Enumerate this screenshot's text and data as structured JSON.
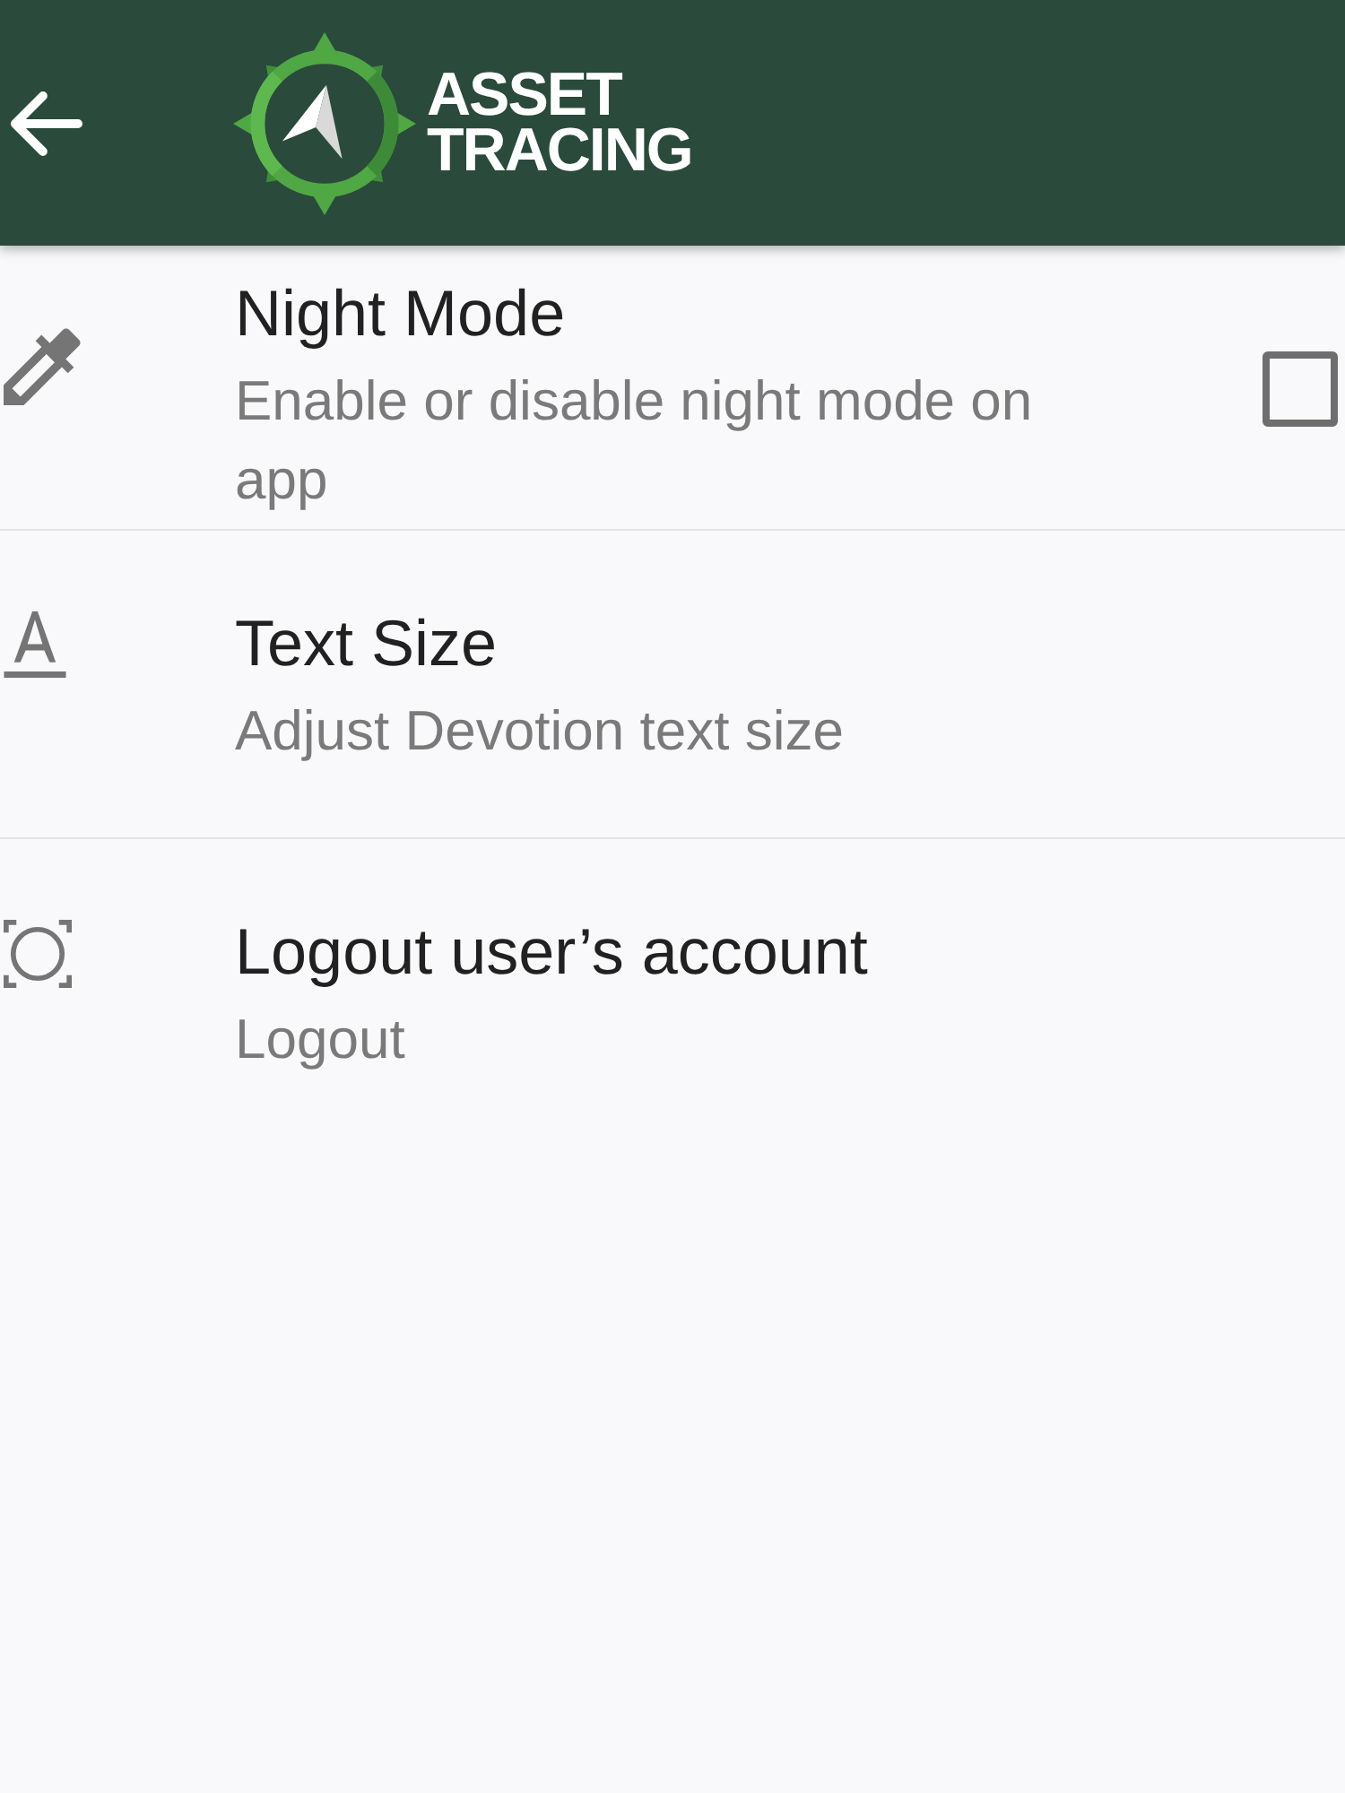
{
  "app_bar": {
    "logo_lines": [
      "ASSET",
      "TRACING"
    ]
  },
  "settings": [
    {
      "kind": "checkbox",
      "title": "Night Mode",
      "subtitle": "Enable or disable night mode on app",
      "checked": false
    },
    {
      "kind": "plain",
      "title": "Text Size",
      "subtitle": "Adjust Devotion text size"
    },
    {
      "kind": "plain",
      "title": "Logout user’s account",
      "subtitle": "Logout"
    }
  ]
}
